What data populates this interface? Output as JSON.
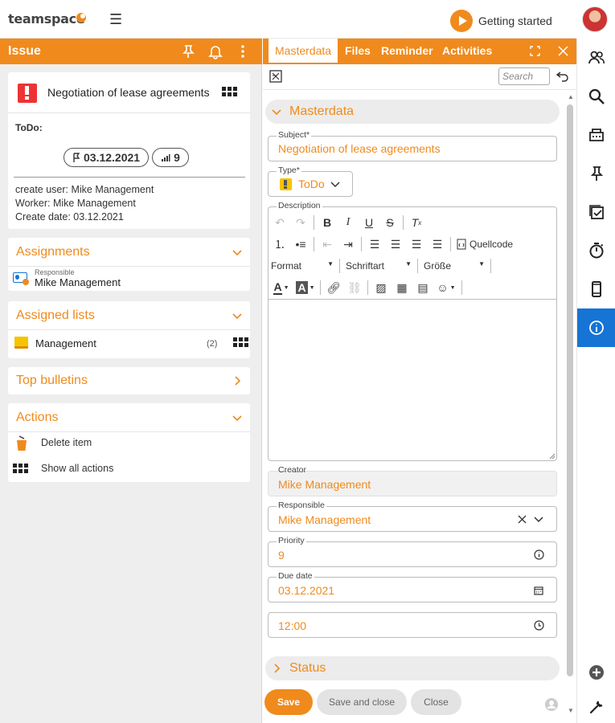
{
  "app": {
    "logo_text": "teamspace",
    "getting_started": "Getting started"
  },
  "left": {
    "header_title": "Issue",
    "issue_card": {
      "title": "Negotiation of lease agreements",
      "status_label": "ToDo:",
      "due_badge": "03.12.2021",
      "priority_badge": "9",
      "create_user": "create user: Mike Management",
      "worker": "Worker: Mike Management",
      "create_date": "Create date: 03.12.2021"
    },
    "assignments": {
      "title": "Assignments",
      "role": "Responsible",
      "name": "Mike Management"
    },
    "assigned_lists": {
      "title": "Assigned lists",
      "item": "Management",
      "count": "(2)"
    },
    "top_bulletins": {
      "title": "Top bulletins"
    },
    "actions": {
      "title": "Actions",
      "delete": "Delete item",
      "show_all": "Show all actions"
    }
  },
  "form": {
    "tabs": [
      "Masterdata",
      "Files",
      "Reminder",
      "Activities"
    ],
    "search_placeholder": "Search",
    "section_masterdata": "Masterdata",
    "subject": {
      "label": "Subject*",
      "value": "Negotiation of lease agreements"
    },
    "type": {
      "label": "Type*",
      "value": "ToDo"
    },
    "description": {
      "label": "Description",
      "source_label": "Quellcode",
      "format_label": "Format",
      "font_label": "Schriftart",
      "size_label": "Größe"
    },
    "creator": {
      "label": "Creator",
      "value": "Mike Management"
    },
    "responsible": {
      "label": "Responsible",
      "value": "Mike Management"
    },
    "priority": {
      "label": "Priority",
      "value": "9"
    },
    "due_date": {
      "label": "Due date",
      "value": "03.12.2021"
    },
    "due_time": {
      "value": "12:00"
    },
    "section_status": "Status",
    "buttons": {
      "save": "Save",
      "save_close": "Save and close",
      "close": "Close"
    }
  },
  "colors": {
    "accent": "#f08a1c",
    "active_rail": "#1574d4"
  }
}
